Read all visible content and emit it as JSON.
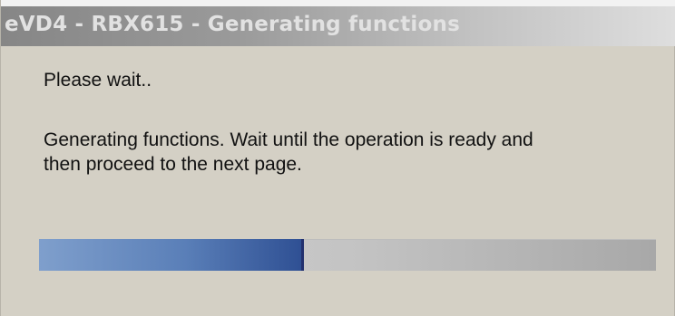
{
  "window": {
    "title": "eVD4 - RBX615 - Generating functions"
  },
  "content": {
    "wait_text": "Please wait..",
    "message_line1": "Generating functions. Wait until the operation is ready and",
    "message_line2": "then proceed to the next page."
  },
  "progress": {
    "fraction": 0.43
  },
  "colors": {
    "title_bar_start": "#868686",
    "title_bar_end": "#dedede",
    "dialog_bg": "#d4d0c5",
    "progress_fill": "#5a7fb8",
    "progress_track": "#c4c4c4"
  }
}
